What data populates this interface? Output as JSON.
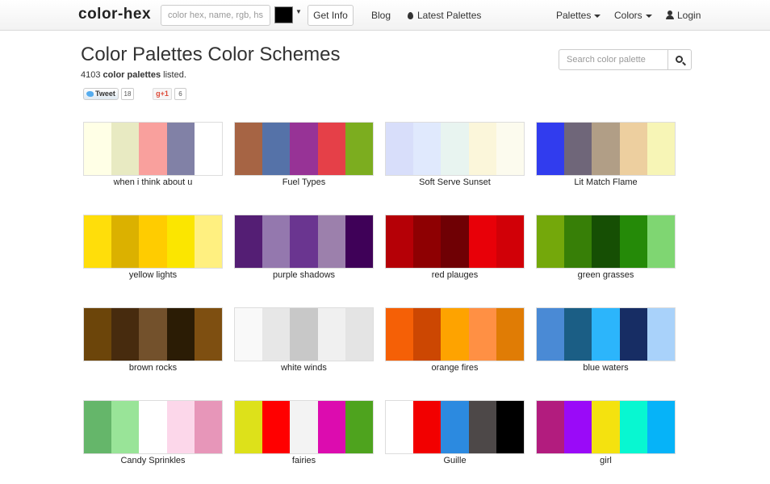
{
  "navbar": {
    "brand": "color-hex",
    "search_placeholder": "color hex, name, rgb, hs",
    "selected_color": "#000000",
    "get_info_label": "Get Info",
    "blog_label": "Blog",
    "latest_palettes_label": "Latest Palettes",
    "palettes_menu_label": "Palettes",
    "colors_menu_label": "Colors",
    "login_label": "Login"
  },
  "header": {
    "title": "Color Palettes Color Schemes",
    "count": "4103",
    "count_label": "color palettes",
    "count_suffix": " listed."
  },
  "search": {
    "placeholder": "Search color palette"
  },
  "social": {
    "tweet_label": "Tweet",
    "tweet_count": "18",
    "gplus_label": "g+1",
    "gplus_count": "6"
  },
  "palettes": [
    {
      "name": "when i think about u",
      "colors": [
        "#ffffe6",
        "#e8eac2",
        "#f9a09d",
        "#8181a6",
        "#ffffff"
      ]
    },
    {
      "name": "Fuel Types",
      "colors": [
        "#a66444",
        "#5572a8",
        "#973396",
        "#e54048",
        "#7cad1f"
      ]
    },
    {
      "name": "Soft Serve Sunset",
      "colors": [
        "#d8defa",
        "#e0e9fd",
        "#e8f4f0",
        "#fbf6da",
        "#fcfbee"
      ]
    },
    {
      "name": "Lit Match Flame",
      "colors": [
        "#313cee",
        "#6f6679",
        "#b19e86",
        "#edcf9f",
        "#f7f5b6"
      ]
    },
    {
      "name": "yellow lights",
      "colors": [
        "#ffde0a",
        "#dbb100",
        "#ffcc00",
        "#fbe600",
        "#fff080"
      ]
    },
    {
      "name": "purple shadows",
      "colors": [
        "#541e74",
        "#9478ae",
        "#6a3590",
        "#9c80ac",
        "#3f0158"
      ]
    },
    {
      "name": "red plauges",
      "colors": [
        "#b50006",
        "#8e0002",
        "#6f0004",
        "#e80008",
        "#d10007"
      ]
    },
    {
      "name": "green grasses",
      "colors": [
        "#74a80b",
        "#377f07",
        "#164f04",
        "#258a08",
        "#7fd672"
      ]
    },
    {
      "name": "brown rocks",
      "colors": [
        "#6c450a",
        "#472b0e",
        "#73512c",
        "#2b1c05",
        "#7e4f11"
      ]
    },
    {
      "name": "white winds",
      "colors": [
        "#f9f9f9",
        "#e7e7e7",
        "#c8c8c8",
        "#f0f0f0",
        "#e4e4e4"
      ]
    },
    {
      "name": "orange fires",
      "colors": [
        "#f56006",
        "#cc4702",
        "#fea300",
        "#ff9044",
        "#e07c05"
      ]
    },
    {
      "name": "blue waters",
      "colors": [
        "#4a8ad5",
        "#1b5e85",
        "#2cb5fb",
        "#172d64",
        "#a9d2fa"
      ]
    },
    {
      "name": "Candy Sprinkles",
      "colors": [
        "#65b66a",
        "#99e498",
        "#ffffff",
        "#fcd7ea",
        "#e796b9"
      ]
    },
    {
      "name": "fairies",
      "colors": [
        "#dde11a",
        "#ff0000",
        "#f3f3f3",
        "#dc0caf",
        "#4ea31e"
      ]
    },
    {
      "name": "Guille",
      "colors": [
        "#ffffff",
        "#f20000",
        "#2c8ae0",
        "#4d4848",
        "#000000"
      ]
    },
    {
      "name": "girl",
      "colors": [
        "#b21c7e",
        "#9a0af8",
        "#f4e20f",
        "#08f7d1",
        "#06b3f8"
      ]
    }
  ]
}
